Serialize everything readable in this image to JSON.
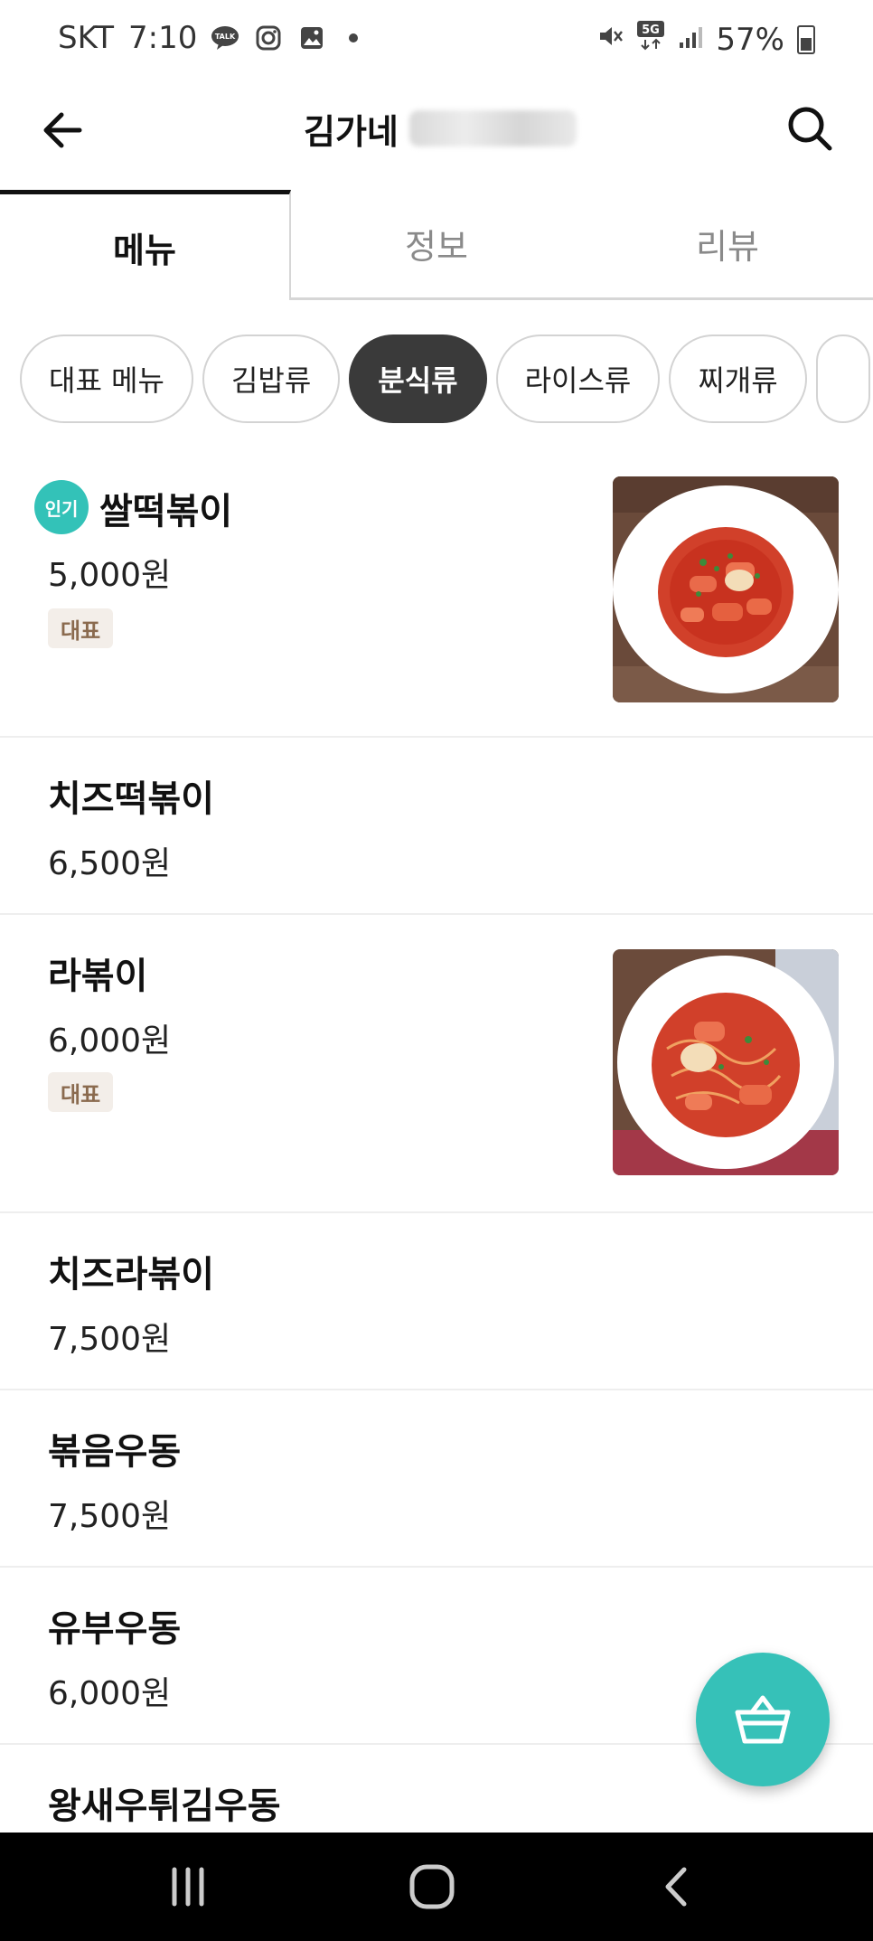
{
  "status_bar": {
    "carrier": "SKT",
    "time": "7:10",
    "talk_icon_text": "TALK",
    "network": "5G",
    "battery": "57%"
  },
  "app_bar": {
    "title": "김가네"
  },
  "tabs": [
    {
      "label": "메뉴",
      "active": true
    },
    {
      "label": "정보",
      "active": false
    },
    {
      "label": "리뷰",
      "active": false
    }
  ],
  "categories": [
    {
      "label": "대표 메뉴",
      "active": false
    },
    {
      "label": "김밥류",
      "active": false
    },
    {
      "label": "분식류",
      "active": true
    },
    {
      "label": "라이스류",
      "active": false
    },
    {
      "label": "찌개류",
      "active": false
    }
  ],
  "menu_items": [
    {
      "name": "쌀떡볶이",
      "price": "5,000원",
      "badge": "대표",
      "popular_label": "인기"
    },
    {
      "name": "치즈떡볶이",
      "price": "6,500원"
    },
    {
      "name": "라볶이",
      "price": "6,000원",
      "badge": "대표"
    },
    {
      "name": "치즈라볶이",
      "price": "7,500원"
    },
    {
      "name": "볶음우동",
      "price": "7,500원"
    },
    {
      "name": "유부우동",
      "price": "6,000원"
    },
    {
      "name": "왕새우튀김우동",
      "price": ""
    }
  ],
  "colors": {
    "accent": "#36c1b8",
    "active_chip": "#3a3a3a",
    "badge_bg": "#f3eee9",
    "badge_text": "#8a6a4e"
  },
  "icons": {
    "back": "arrow-left-icon",
    "search": "search-icon",
    "cart": "basket-icon"
  }
}
